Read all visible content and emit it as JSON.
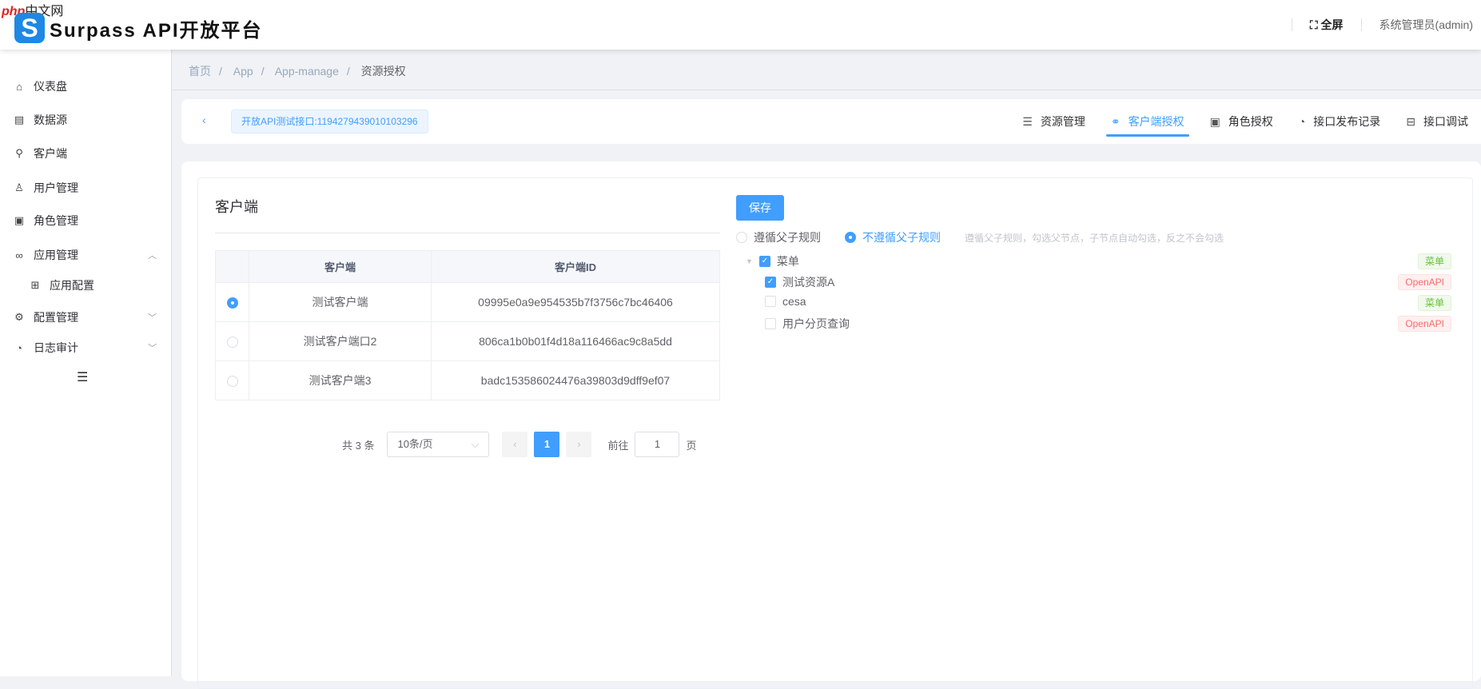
{
  "watermark": {
    "php": "php",
    "cn": "中文网"
  },
  "header": {
    "logo_letter": "S",
    "title": "Surpass API开放平台",
    "fullscreen": "全屏",
    "user": "系统管理员(admin)"
  },
  "sidebar": {
    "items": [
      {
        "label": "仪表盘",
        "icon": "⌂"
      },
      {
        "label": "数据源",
        "icon": "▤"
      },
      {
        "label": "客户端",
        "icon": "⚲"
      },
      {
        "label": "用户管理",
        "icon": "♙"
      },
      {
        "label": "角色管理",
        "icon": "▣"
      },
      {
        "label": "应用管理",
        "icon": "∞",
        "arrow": "︿"
      },
      {
        "label": "应用配置",
        "icon": "⊞"
      },
      {
        "label": "配置管理",
        "icon": "⚙",
        "arrow": "﹀"
      },
      {
        "label": "日志审计",
        "icon": "◔",
        "arrow": "﹀"
      }
    ],
    "collapse_icon": "☰"
  },
  "breadcrumb": [
    "首页",
    "App",
    "App-manage",
    "资源授权"
  ],
  "topbar": {
    "back": "‹",
    "app_tag": "开放API测试接口:1194279439010103296",
    "tabs": [
      {
        "label": "资源管理",
        "icon": "☰"
      },
      {
        "label": "客户端授权",
        "icon": "⚭",
        "active": true
      },
      {
        "label": "角色授权",
        "icon": "▣"
      },
      {
        "label": "接口发布记录",
        "icon": "◔"
      },
      {
        "label": "接口调试",
        "icon": "⊟"
      }
    ]
  },
  "clients": {
    "title": "客户端",
    "columns": [
      "",
      "客户端",
      "客户端ID"
    ],
    "rows": [
      {
        "name": "测试客户端",
        "id": "09995e0a9e954535b7f3756c7bc46406",
        "selected": true
      },
      {
        "name": "测试客户端口2",
        "id": "806ca1b0b01f4d18a116466ac9c8a5dd",
        "selected": false
      },
      {
        "name": "测试客户端3",
        "id": "badc153586024476a39803d9dff9ef07",
        "selected": false
      }
    ],
    "pagination": {
      "total": "共 3 条",
      "page_size": "10条/页",
      "current": "1",
      "goto_label": "前往",
      "goto_value": "1",
      "page_suffix": "页",
      "prev": "‹",
      "next": "›"
    }
  },
  "resources": {
    "save": "保存",
    "rule_options": [
      "遵循父子规则",
      "不遵循父子规则"
    ],
    "rule_selected": 1,
    "hint": "遵循父子规则，勾选父节点，子节点自动勾选，反之不会勾选",
    "tree": [
      {
        "label": "菜单",
        "tag": "菜单",
        "checked": true,
        "level": 0
      },
      {
        "label": "测试资源A",
        "tag": "OpenAPI",
        "checked": true,
        "level": 1
      },
      {
        "label": "cesa",
        "tag": "菜单",
        "checked": false,
        "level": 1
      },
      {
        "label": "用户分页查询",
        "tag": "OpenAPI",
        "checked": false,
        "level": 1
      }
    ]
  }
}
